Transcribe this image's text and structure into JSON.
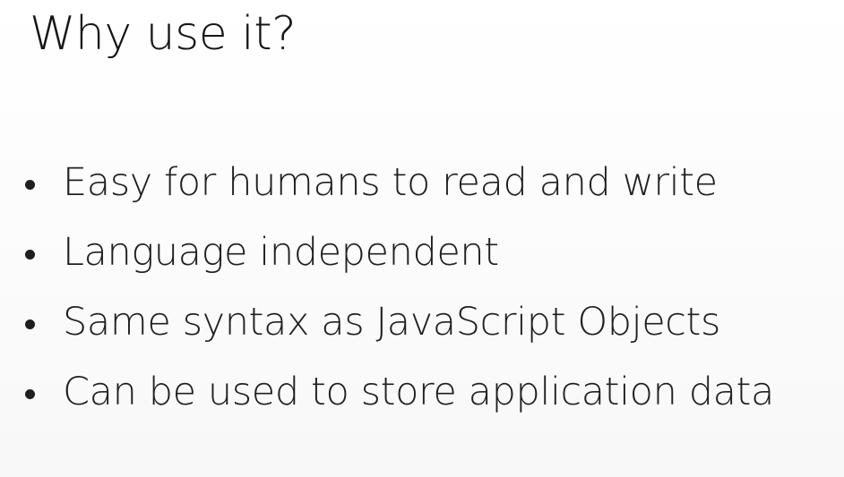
{
  "slide": {
    "title": "Why use it?",
    "bullets": [
      "Easy for humans to read and write",
      "Language independent",
      "Same syntax as JavaScript Objects",
      "Can be used to store application data"
    ]
  }
}
